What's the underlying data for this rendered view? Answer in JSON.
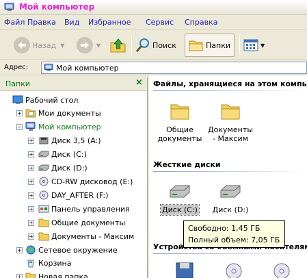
{
  "window": {
    "title": "Мой компьютер",
    "title_color": "#e02ad6"
  },
  "menu": [
    "Файл",
    "Правка",
    "Вид",
    "Избранное",
    "Сервис",
    "Справка"
  ],
  "toolbar": {
    "back": "Назад",
    "search": "Поиск",
    "folders": "Папки"
  },
  "address": {
    "label": "Адрес:",
    "value": "Мой компьютер"
  },
  "folders_pane": {
    "title": "Папки",
    "close": "×",
    "items": [
      {
        "label": "Рабочий стол",
        "icon": "desktop-icon"
      },
      {
        "label": "Мои документы",
        "icon": "my-documents-icon"
      },
      {
        "label": "Мой компьютер",
        "icon": "my-computer-icon",
        "selected": true
      },
      {
        "label": "Диск 3,5 (A:)",
        "icon": "floppy-icon"
      },
      {
        "label": "Диск (C:)",
        "icon": "hard-drive-icon"
      },
      {
        "label": "Диск (D:)",
        "icon": "hard-drive-icon"
      },
      {
        "label": "CD-RW дисковод (E:)",
        "icon": "cd-drive-icon"
      },
      {
        "label": "DAY_AFTER (F:)",
        "icon": "cd-drive-icon"
      },
      {
        "label": "Панель управления",
        "icon": "control-panel-icon"
      },
      {
        "label": "Общие документы",
        "icon": "folder-icon"
      },
      {
        "label": "Документы - Максим",
        "icon": "folder-icon"
      },
      {
        "label": "Сетевое окружение",
        "icon": "network-icon"
      },
      {
        "label": "Корзина",
        "icon": "recycle-bin-icon"
      },
      {
        "label": "Новая папка",
        "icon": "folder-icon"
      }
    ]
  },
  "content": {
    "group_files": "Файлы, хранящиеся на этом компьютере",
    "folders": [
      {
        "line1": "Общие",
        "line2": "документы"
      },
      {
        "line1": "Документы",
        "line2": "- Максим"
      }
    ],
    "group_drives": "Жесткие диски",
    "drives": [
      {
        "label": "Диск (C:)",
        "selected": true
      },
      {
        "label": "Диск (D:)"
      }
    ],
    "group_devices": "Устройства со съемными носителями"
  },
  "tooltip": {
    "free": "Свободно: 1,45 ГБ",
    "total": "Полный объем: 7,05 ГБ"
  }
}
